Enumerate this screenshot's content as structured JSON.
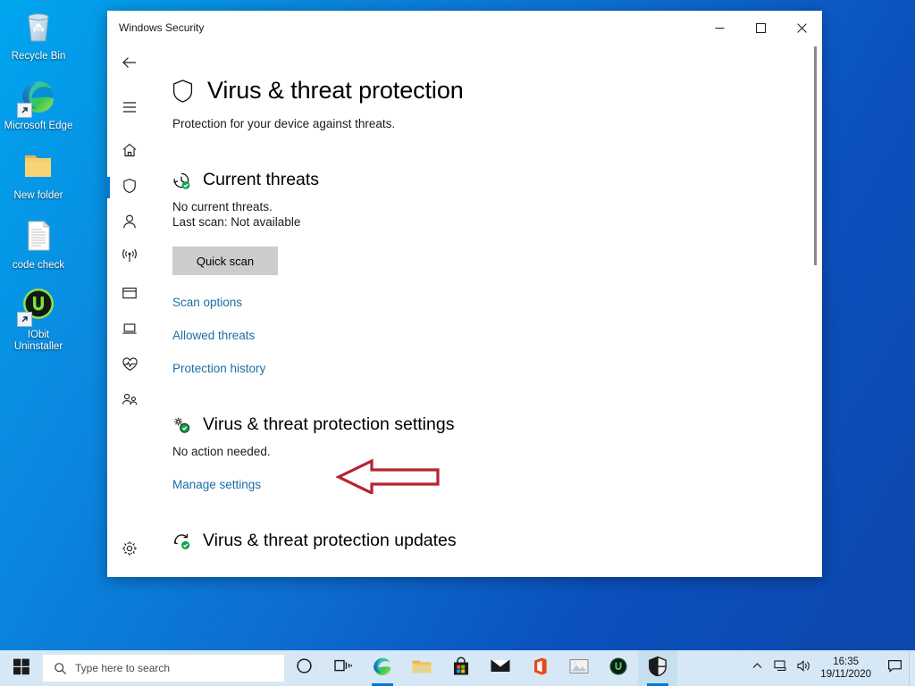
{
  "desktop": {
    "icons": [
      {
        "name": "recycle-bin",
        "label": "Recycle Bin",
        "shortcut": false
      },
      {
        "name": "microsoft-edge",
        "label": "Microsoft Edge",
        "shortcut": true
      },
      {
        "name": "new-folder",
        "label": "New folder",
        "shortcut": false
      },
      {
        "name": "code-check",
        "label": "code check",
        "shortcut": false
      },
      {
        "name": "iobit-uninstaller",
        "label": "IObit Uninstaller",
        "shortcut": true
      }
    ]
  },
  "window": {
    "title": "Windows Security",
    "controls": {
      "minimize": "Minimize",
      "maximize": "Maximize",
      "close": "Close"
    },
    "rail": [
      {
        "name": "back",
        "icon": "back-arrow-icon",
        "label": "Back",
        "selected": false
      },
      {
        "name": "menu",
        "icon": "hamburger-menu-icon",
        "label": "Menu",
        "selected": false
      },
      {
        "name": "home",
        "icon": "home-icon",
        "label": "Home",
        "selected": false
      },
      {
        "name": "virus-threat-protection",
        "icon": "shield-icon",
        "label": "Virus & threat protection",
        "selected": true
      },
      {
        "name": "account-protection",
        "icon": "person-icon",
        "label": "Account protection",
        "selected": false
      },
      {
        "name": "firewall-network-protection",
        "icon": "wifi-icon",
        "label": "Firewall & network protection",
        "selected": false
      },
      {
        "name": "app-browser-control",
        "icon": "app-window-icon",
        "label": "App & browser control",
        "selected": false
      },
      {
        "name": "device-security",
        "icon": "laptop-icon",
        "label": "Device security",
        "selected": false
      },
      {
        "name": "device-performance-health",
        "icon": "heart-pulse-icon",
        "label": "Device performance & health",
        "selected": false
      },
      {
        "name": "family-options",
        "icon": "family-icon",
        "label": "Family options",
        "selected": false
      }
    ],
    "rail_settings": {
      "name": "settings",
      "icon": "gear-icon",
      "label": "Settings"
    },
    "page": {
      "title": "Virus & threat protection",
      "title_icon": "shield-icon",
      "subtitle": "Protection for your device against threats.",
      "sections": [
        {
          "name": "current-threats",
          "icon": "history-check-icon",
          "title": "Current threats",
          "line1": "No current threats.",
          "line2": "Last scan: Not available",
          "button": "Quick scan",
          "links": [
            "Scan options",
            "Allowed threats",
            "Protection history"
          ]
        },
        {
          "name": "virus-threat-protection-settings",
          "icon": "gear-check-icon",
          "title": "Virus & threat protection settings",
          "line1": "No action needed.",
          "links": [
            "Manage settings"
          ]
        },
        {
          "name": "virus-threat-protection-updates",
          "icon": "refresh-check-icon",
          "title": "Virus & threat protection updates",
          "links": []
        }
      ]
    }
  },
  "annotation": {
    "arrow_color": "#b52430",
    "points_to": "Manage settings"
  },
  "taskbar": {
    "start_label": "Start",
    "search": {
      "placeholder": "Type here to search",
      "icon": "search-icon"
    },
    "items": [
      {
        "name": "cortana",
        "icon": "circle-icon",
        "label": "Cortana",
        "running": false,
        "active": false
      },
      {
        "name": "task-view",
        "icon": "task-view-icon",
        "label": "Task View",
        "running": false,
        "active": false
      },
      {
        "name": "microsoft-edge",
        "icon": "edge-icon",
        "label": "Microsoft Edge",
        "running": true,
        "active": false
      },
      {
        "name": "file-explorer",
        "icon": "folder-icon",
        "label": "File Explorer",
        "running": false,
        "active": false
      },
      {
        "name": "microsoft-store",
        "icon": "store-icon",
        "label": "Microsoft Store",
        "running": false,
        "active": false
      },
      {
        "name": "mail",
        "icon": "mail-icon",
        "label": "Mail",
        "running": false,
        "active": false
      },
      {
        "name": "office",
        "icon": "office-icon",
        "label": "Office",
        "running": false,
        "active": false
      },
      {
        "name": "photos",
        "icon": "photos-icon",
        "label": "Photos",
        "running": false,
        "active": false
      },
      {
        "name": "iobit-uninstaller",
        "icon": "iobit-icon",
        "label": "IObit Uninstaller",
        "running": false,
        "active": false
      },
      {
        "name": "windows-security",
        "icon": "security-shield-icon",
        "label": "Windows Security",
        "running": true,
        "active": true
      }
    ],
    "tray": [
      {
        "name": "show-hidden-icons",
        "icon": "chevron-up-icon",
        "label": "Show hidden icons"
      },
      {
        "name": "network",
        "icon": "network-icon",
        "label": "Network"
      },
      {
        "name": "volume",
        "icon": "volume-icon",
        "label": "Volume"
      }
    ],
    "clock": {
      "time": "16:35",
      "date": "19/11/2020"
    },
    "action_center": {
      "name": "action-center",
      "icon": "speech-bubble-icon",
      "label": "Action Center"
    }
  },
  "colors": {
    "accent": "#0078d4",
    "link": "#1a6ea8",
    "annotation_red": "#b52430",
    "button_gray": "#cccccc",
    "green_check": "#12a14b"
  }
}
